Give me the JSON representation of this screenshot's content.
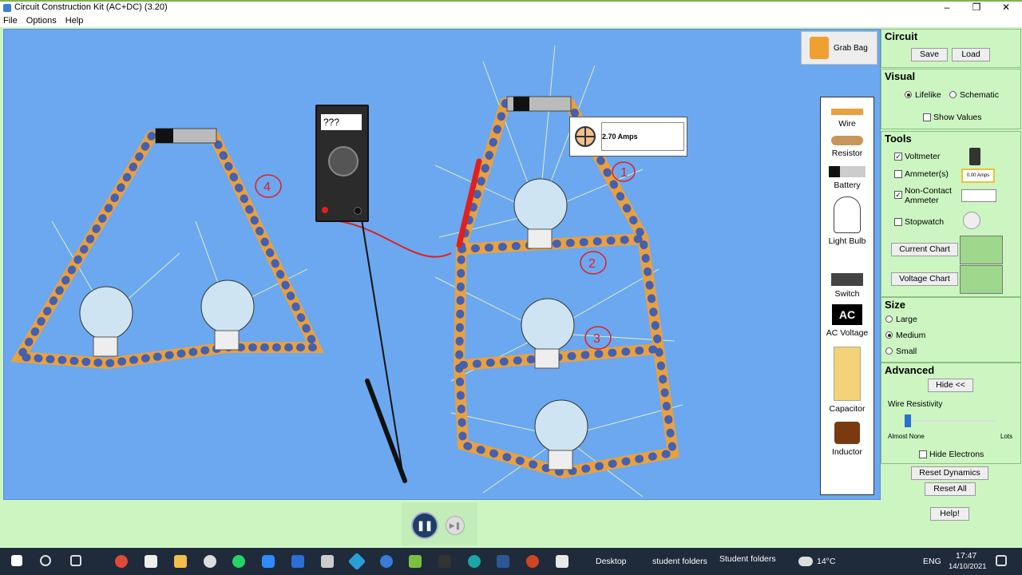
{
  "window": {
    "title": "Circuit Construction Kit (AC+DC) (3.20)"
  },
  "menu": [
    "File",
    "Options",
    "Help"
  ],
  "grab_bag": {
    "label": "Grab Bag"
  },
  "toolbox": [
    {
      "label": "Wire"
    },
    {
      "label": "Resistor"
    },
    {
      "label": "Battery"
    },
    {
      "label": "Light Bulb"
    },
    {
      "label": "Switch"
    },
    {
      "label": "AC Voltage"
    },
    {
      "label": "Capacitor"
    },
    {
      "label": "Inductor"
    }
  ],
  "circuit_panel": {
    "title": "Circuit",
    "save": "Save",
    "load": "Load"
  },
  "visual_panel": {
    "title": "Visual",
    "lifelike": "Lifelike",
    "schematic": "Schematic",
    "show_values": "Show Values",
    "selected": "Lifelike"
  },
  "tools_panel": {
    "title": "Tools",
    "voltmeter": {
      "label": "Voltmeter",
      "checked": true
    },
    "ammeters": {
      "label": "Ammeter(s)",
      "checked": false
    },
    "noncontact": {
      "label": "Non-Contact Ammeter",
      "checked": true
    },
    "stopwatch": {
      "label": "Stopwatch",
      "checked": false
    },
    "current_chart": "Current Chart",
    "voltage_chart": "Voltage Chart",
    "ammeter_icon_text": "0.00 Amps"
  },
  "size_panel": {
    "title": "Size",
    "large": "Large",
    "medium": "Medium",
    "small": "Small",
    "selected": "Medium"
  },
  "advanced_panel": {
    "title": "Advanced",
    "hide": "Hide <<",
    "wire_resistivity": "Wire Resistivity",
    "min": "Almost None",
    "max": "Lots",
    "hide_electrons": "Hide Electrons"
  },
  "buttons": {
    "reset_dynamics": "Reset Dynamics",
    "reset_all": "Reset All",
    "help": "Help!"
  },
  "voltmeter": {
    "display": "???"
  },
  "noncontact_reading": "2.70 Amps",
  "annotations": [
    "4",
    "1",
    "2",
    "3"
  ],
  "taskbar": {
    "desktop": "Desktop",
    "student1": "student folders",
    "student2": "Student folders",
    "temp": "14°C",
    "lang": "ENG",
    "time": "17:47",
    "date": "14/10/2021"
  }
}
